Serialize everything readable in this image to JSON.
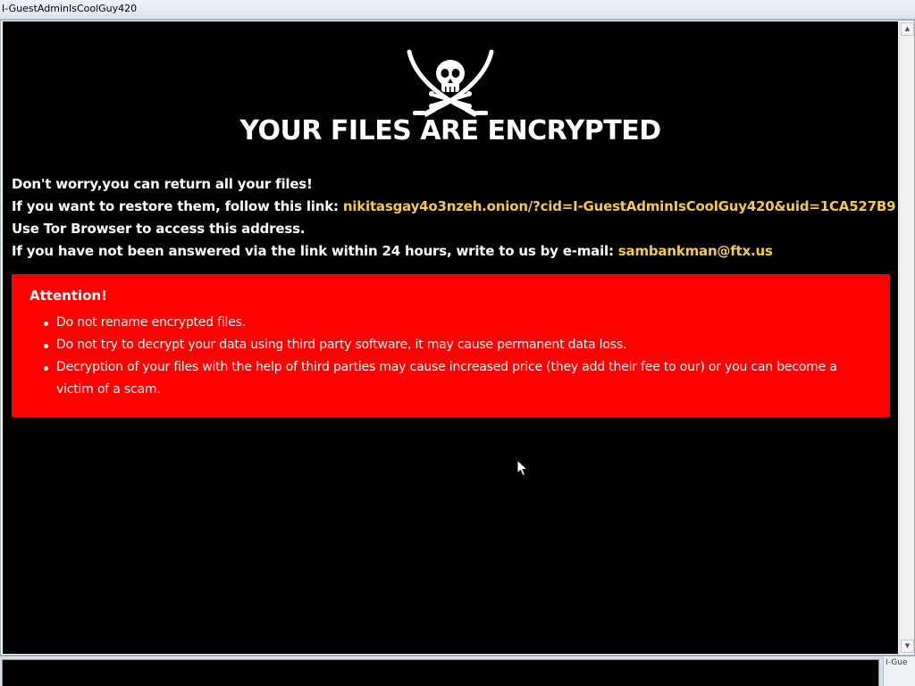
{
  "window": {
    "title": "I-GuestAdminIsCoolGuy420"
  },
  "note": {
    "logo_icon": "jolly-roger-icon",
    "headline": "YOUR FILES ARE ENCRYPTED",
    "line1": "Don't worry,you can return all your files!",
    "line2_prefix": "If you want to restore them, follow this link: ",
    "link": "nikitasgay4o3nzeh.onion/?cid=I-GuestAdminIsCoolGuy420&uid=1CA527B9",
    "line3": "Use Tor Browser to access this address.",
    "line4_prefix": "If you have not been answered via the link within 24 hours, write to us by e-mail: ",
    "email": "sambankman@ftx.us",
    "highlight_color": "#f5c84c"
  },
  "attention": {
    "title": "Attention!",
    "items": [
      "Do not rename encrypted files.",
      "Do not try to decrypt your data using third party software, it may cause permanent data loss.",
      "Decryption of your files with the help of third parties may cause increased price (they add their fee to our) or you can become a victim of a scam."
    ],
    "background_color": "#ff0000"
  },
  "taskbar": {
    "mini_title": "I-Gue"
  }
}
